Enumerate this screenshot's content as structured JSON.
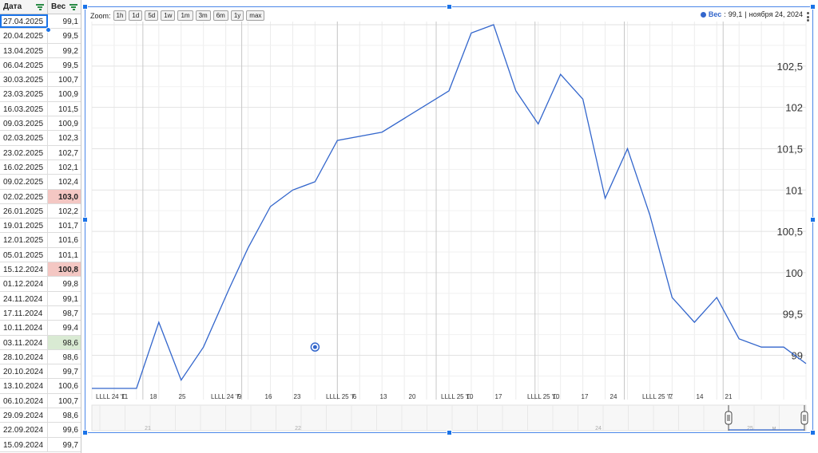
{
  "sheet": {
    "headers": {
      "date": "Дата",
      "value": "Вес"
    },
    "rows": [
      {
        "date": "27.04.2025",
        "value": "99,1"
      },
      {
        "date": "20.04.2025",
        "value": "99,5"
      },
      {
        "date": "13.04.2025",
        "value": "99,2"
      },
      {
        "date": "06.04.2025",
        "value": "99,5"
      },
      {
        "date": "30.03.2025",
        "value": "100,7"
      },
      {
        "date": "23.03.2025",
        "value": "100,9"
      },
      {
        "date": "16.03.2025",
        "value": "101,5"
      },
      {
        "date": "09.03.2025",
        "value": "100,9"
      },
      {
        "date": "02.03.2025",
        "value": "102,3"
      },
      {
        "date": "23.02.2025",
        "value": "102,7"
      },
      {
        "date": "16.02.2025",
        "value": "102,1"
      },
      {
        "date": "09.02.2025",
        "value": "102,4"
      },
      {
        "date": "02.02.2025",
        "value": "103,0"
      },
      {
        "date": "26.01.2025",
        "value": "102,2"
      },
      {
        "date": "19.01.2025",
        "value": "101,7"
      },
      {
        "date": "12.01.2025",
        "value": "101,6"
      },
      {
        "date": "05.01.2025",
        "value": "101,1"
      },
      {
        "date": "15.12.2024",
        "value": "100,8"
      },
      {
        "date": "01.12.2024",
        "value": "99,8"
      },
      {
        "date": "24.11.2024",
        "value": "99,1"
      },
      {
        "date": "17.11.2024",
        "value": "98,7"
      },
      {
        "date": "10.11.2024",
        "value": "99,4"
      },
      {
        "date": "03.11.2024",
        "value": "98,6"
      },
      {
        "date": "28.10.2024",
        "value": "98,6"
      },
      {
        "date": "20.10.2024",
        "value": "99,7"
      },
      {
        "date": "13.10.2024",
        "value": "100,6"
      },
      {
        "date": "06.10.2024",
        "value": "100,7"
      },
      {
        "date": "29.09.2024",
        "value": "98,6"
      },
      {
        "date": "22.09.2024",
        "value": "99,6"
      },
      {
        "date": "15.09.2024",
        "value": "99,7"
      }
    ],
    "highlight_red_rows": [
      12,
      17
    ],
    "highlight_green_rows": [
      22
    ],
    "selected_row": 0,
    "colors": {
      "red_fill": "#f4c7c3",
      "green_fill": "#d9ead3",
      "selection": "#1a73e8"
    }
  },
  "chart": {
    "zoom_label": "Zoom:",
    "zoom_buttons": [
      "1h",
      "1d",
      "5d",
      "1w",
      "1m",
      "3m",
      "6m",
      "1y",
      "max"
    ],
    "legend": {
      "series": "Вес",
      "separator": ":",
      "value": "99,1",
      "date": "ноября 24, 2024"
    },
    "line_color": "#3366cc"
  },
  "chart_data": {
    "type": "line",
    "ylim": [
      98.6,
      103.0
    ],
    "y_ticks": [
      "99",
      "99,5",
      "100",
      "100,5",
      "101",
      "101,5",
      "102",
      "102,5"
    ],
    "y_tick_values": [
      99,
      99.5,
      100,
      100.5,
      101,
      101.5,
      102,
      102.5
    ],
    "x_tick_labels": [
      "LLLL 24 'Г.",
      "11",
      "18",
      "25",
      "LLLL 24 'Г.",
      "9",
      "16",
      "23",
      "LLLL 25 'Г.",
      "6",
      "13",
      "20",
      "LLLL 25 'Г.",
      "10",
      "17",
      "LLLL 25 'Г.",
      "10",
      "17",
      "24",
      "LLLL 25 'Г.",
      "7",
      "14",
      "21"
    ],
    "navigator_labels": [
      "21",
      "22",
      "24",
      "25",
      "м"
    ],
    "x": [
      "2024-09-15",
      "2024-09-22",
      "2024-09-29",
      "2024-10-06",
      "2024-10-13",
      "2024-10-20",
      "2024-10-28",
      "2024-11-03",
      "2024-11-10",
      "2024-11-17",
      "2024-11-24",
      "2024-12-01",
      "2024-12-15",
      "2025-01-05",
      "2025-01-12",
      "2025-01-19",
      "2025-01-26",
      "2025-02-02",
      "2025-02-09",
      "2025-02-16",
      "2025-02-23",
      "2025-03-02",
      "2025-03-09",
      "2025-03-16",
      "2025-03-23",
      "2025-03-30",
      "2025-04-06",
      "2025-04-13",
      "2025-04-20",
      "2025-04-27"
    ],
    "series": [
      {
        "values": [
          98.6,
          98.6,
          98.6,
          99.4,
          98.7,
          99.1,
          99.8,
          100.3,
          100.8,
          101.0,
          101.1,
          101.6,
          101.7,
          102.2,
          102.9,
          103.0,
          102.2,
          101.8,
          102.4,
          102.1,
          100.9,
          101.5,
          100.7,
          99.7,
          99.4,
          99.7,
          99.2,
          99.1,
          99.1,
          98.9
        ]
      }
    ],
    "marker": {
      "x": "2024-11-24",
      "value": 99.1
    },
    "grid": true,
    "legend_position": "top-right"
  }
}
